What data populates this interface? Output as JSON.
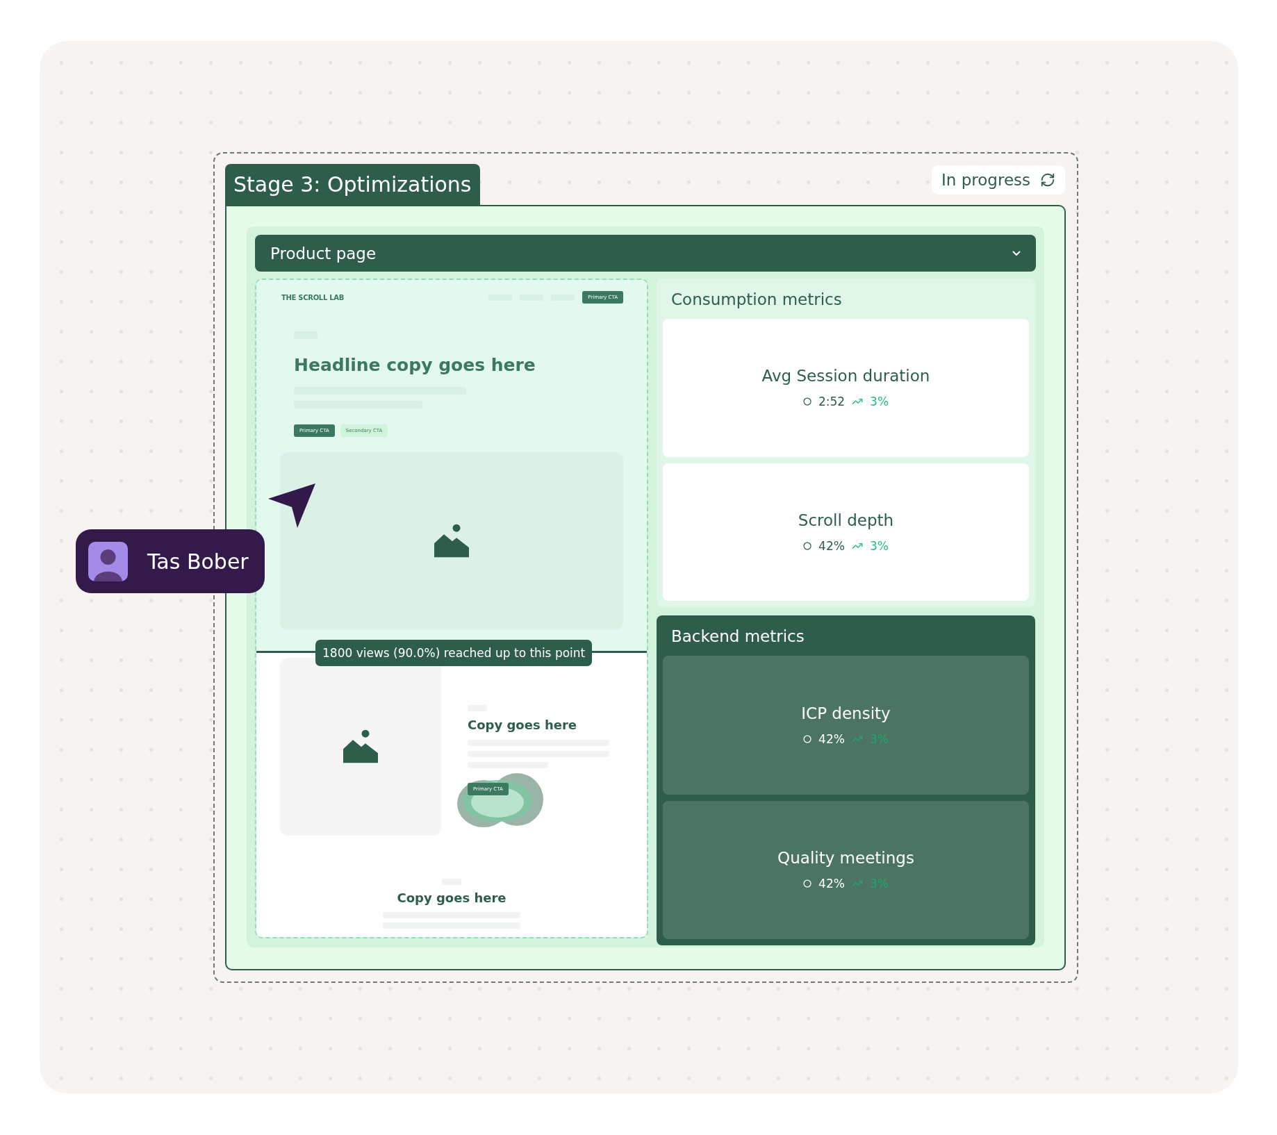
{
  "stage": {
    "title": "Stage 3: Optimizations",
    "status": "In progress"
  },
  "page_selector": {
    "value": "Product page"
  },
  "preview": {
    "logo": "THE SCROLL LAB",
    "nav_cta": "Primary CTA",
    "headline": "Headline copy goes here",
    "primary_cta": "Primary CTA",
    "secondary_cta": "Secondary CTA",
    "section_title": "Copy goes here",
    "section_cta": "Primary CTA",
    "footer_title": "Copy goes here",
    "scroll_marker": "1800 views (90.0%) reached up to this point"
  },
  "metric_groups": [
    {
      "title": "Consumption metrics",
      "kind": "light",
      "metrics": [
        {
          "name": "Avg Session duration",
          "value": "2:52",
          "change": "3%"
        },
        {
          "name": "Scroll depth",
          "value": "42%",
          "change": "3%"
        }
      ]
    },
    {
      "title": "Backend metrics",
      "kind": "dark",
      "metrics": [
        {
          "name": "ICP density",
          "value": "42%",
          "change": "3%"
        },
        {
          "name": "Quality meetings",
          "value": "42%",
          "change": "3%"
        }
      ]
    }
  ],
  "cursor": {
    "name": "Tas Bober"
  }
}
